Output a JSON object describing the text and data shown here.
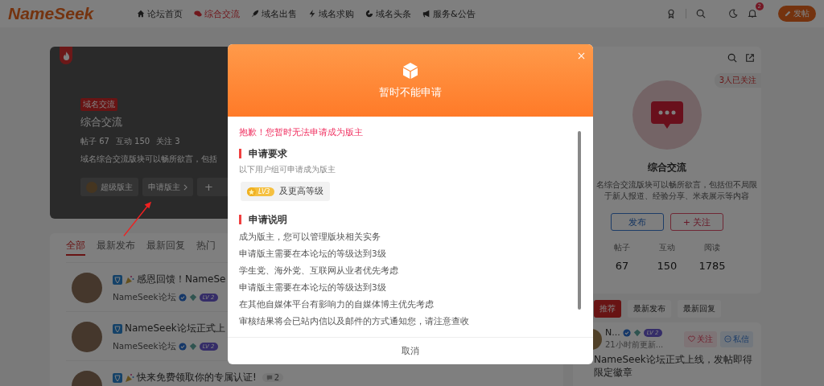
{
  "header": {
    "logo": "NameSeek",
    "nav": [
      {
        "label": "论坛首页",
        "selected": false
      },
      {
        "label": "综合交流",
        "selected": true
      },
      {
        "label": "域名出售",
        "selected": false
      },
      {
        "label": "域名求购",
        "selected": false
      },
      {
        "label": "域名头条",
        "selected": false
      },
      {
        "label": "服务&公告",
        "selected": false
      }
    ],
    "notification_count": "2",
    "post_button": "发帖"
  },
  "forum_hero": {
    "tag": "域名交流",
    "title": "综合交流",
    "stats": [
      {
        "label": "帖子",
        "value": "67"
      },
      {
        "label": "互动",
        "value": "150"
      },
      {
        "label": "关注",
        "value": "3"
      }
    ],
    "description": "域名综合交流版块可以畅所欲言，包括",
    "moderator_button": "超级版主",
    "apply_button": "申请版主",
    "more_button": "+"
  },
  "post_tabs": [
    {
      "label": "全部",
      "selected": true
    },
    {
      "label": "最新发布",
      "selected": false
    },
    {
      "label": "最新回复",
      "selected": false
    },
    {
      "label": "热门",
      "selected": false
    }
  ],
  "posts": [
    {
      "title": "感恩回馈！NameSe",
      "party": true,
      "author": "NameSeek论坛",
      "level": "LV 2"
    },
    {
      "title": "NameSeek论坛正式上",
      "party": false,
      "author": "NameSeek论坛",
      "level": "LV 2"
    },
    {
      "title": "快来免费领取你的专属认证!",
      "party": true,
      "replies": "2"
    }
  ],
  "sidebar_forum": {
    "followers": "3人已关注",
    "title": "综合交流",
    "description": "名综合交流版块可以畅所欲言，包括但不局限于新人报道、经验分享、米表展示等内容",
    "publish_button": "发布",
    "follow_button": "+ 关注",
    "stats": [
      {
        "label": "帖子",
        "value": "67"
      },
      {
        "label": "互动",
        "value": "150"
      },
      {
        "label": "阅读",
        "value": "1785"
      }
    ]
  },
  "sidebar_tabs": [
    {
      "label": "推荐",
      "selected": true
    },
    {
      "label": "最新发布",
      "selected": false
    },
    {
      "label": "最新回复",
      "selected": false
    }
  ],
  "sidebar_post": {
    "author": "N...",
    "level": "LV 2",
    "time": "21小时前更新...",
    "follow_button": "关注",
    "message_button": "私信",
    "title": "NameSeek论坛正式上线，发帖即得限定徽章"
  },
  "modal": {
    "title": "暂时不能申请",
    "error": "抱歉！您暂时无法申请成为版主",
    "sections": [
      {
        "kind": "requirements",
        "heading": "申请要求",
        "note": "以下用户组可申请成为版主",
        "level": "LV3",
        "level_text": "及更高等级"
      },
      {
        "kind": "list",
        "heading": "申请说明",
        "items": [
          "成为版主，您可以管理版块相关实务",
          "申请版主需要在本论坛的等级达到3级",
          "学生党、海外党、互联网从业者优先考虑",
          "申请版主需要在本论坛的等级达到3级",
          "在其他自媒体平台有影响力的自媒体博主优先考虑",
          "审核结果将会已站内信以及邮件的方式通知您，请注意查收"
        ]
      }
    ],
    "cancel_button": "取消"
  }
}
